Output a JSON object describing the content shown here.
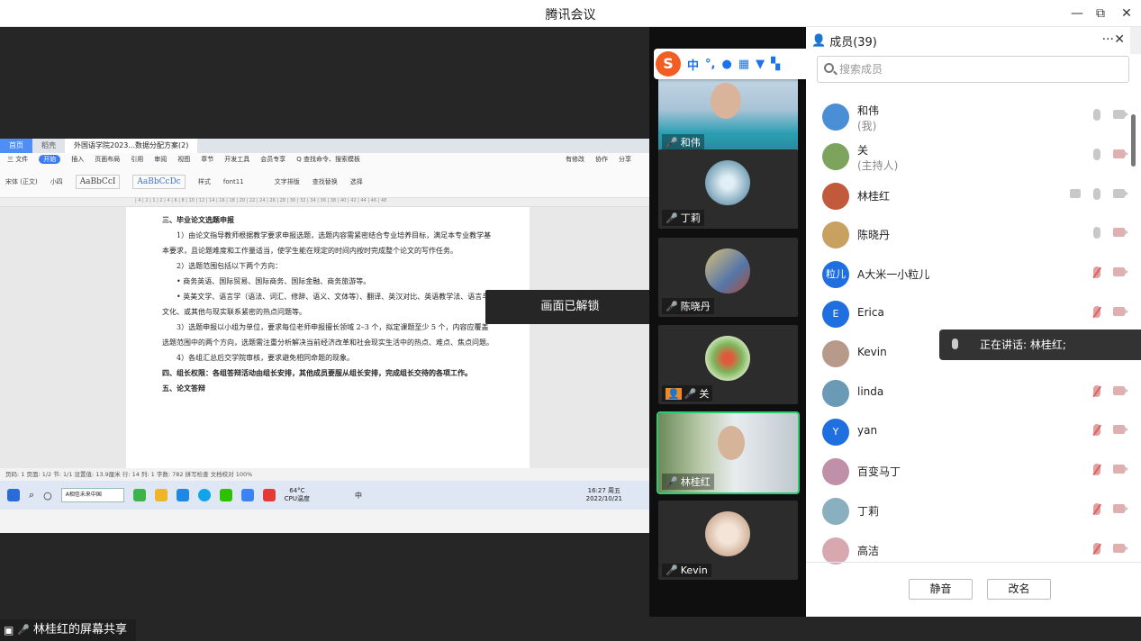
{
  "window": {
    "title": "腾讯会议",
    "minimize": "—",
    "restore": "⧉",
    "close": "✕"
  },
  "shared_screen": {
    "wps_tabs": [
      "首页",
      "稻壳",
      "外国语学院2023...数据分配方案(2)"
    ],
    "wps_menu": [
      "三 文件",
      "开始",
      "插入",
      "页面布局",
      "引用",
      "审阅",
      "视图",
      "章节",
      "开发工具",
      "会员专享",
      "Q 查找命令、搜索模板"
    ],
    "wps_menu_right": [
      "有修改",
      "协作",
      "分享"
    ],
    "ribbon": {
      "font": "宋体 (正文)",
      "size": "小四",
      "style_sample1": "AaBbCcI",
      "style_sample2": "AaBbCcDc",
      "style_label": "样式",
      "font11": "font11",
      "text_layout": "文字排版",
      "find_replace": "查找替换",
      "select": "选择"
    },
    "doc_lines": [
      {
        "text": "三、毕业论文选题申报",
        "cls": "h"
      },
      {
        "text": "1）由论文指导教师根据教学要求申报选题，选题内容需紧密结合专业培养目标，满足本专业教学基本要求，且论题难度和工作量适当，使学生能在规定的时间内按时完成整个论文的写作任务。",
        "cls": "ind"
      },
      {
        "text": "2）选题范围包括以下两个方向：",
        "cls": "ind"
      },
      {
        "text": "• 商务英语、国际贸易、国际商务、国际金融、商务旅游等。",
        "cls": "ind"
      },
      {
        "text": "• 英美文学、语言学（语法、词汇、修辞、语义、文体等）、翻译、英汉对比、英语教学法、语言与文化、或其他与现实联系紧密的热点问题等。",
        "cls": "ind"
      },
      {
        "text": "3）选题申报以小组为单位，要求每位老师申报擅长领域 2–3 个，拟定课题至少 5 个，内容应覆盖选题范围中的两个方向，选题需注重分析解决当前经济改革和社会现实生活中的热点、难点、焦点问题。",
        "cls": "ind"
      },
      {
        "text": "4）各组汇总后交学院审核，要求避免相同命题的现象。",
        "cls": "ind"
      },
      {
        "text": "四、组长权限：各组答辩活动由组长安排，其他成员要服从组长安排，完成组长交待的各项工作。",
        "cls": "h"
      },
      {
        "text": "五、论文答辩",
        "cls": "h"
      }
    ],
    "status_bar": "页码: 1   页面: 1/2   节: 1/1   设置值: 13.9厘米   行: 14   列: 1   字数: 782   拼写检查   文档校对                                            100%",
    "taskbar": {
      "search": "A相信未来中国",
      "weather_temp": "64°C",
      "weather_label": "CPU温度",
      "time": "16:27 周五",
      "date": "2022/10/21",
      "ime": "中"
    },
    "unlock_toast": "画面已解锁",
    "sharer_label": "林桂红的屏幕共享"
  },
  "ime_bar": {
    "logo": "S",
    "mode": "中",
    "punct": "°,",
    "items": [
      "mic",
      "keyboard",
      "shirt",
      "grid"
    ]
  },
  "video_tiles": [
    {
      "name": "和伟",
      "mic": "on"
    },
    {
      "name": "丁莉",
      "mic": "muted"
    },
    {
      "name": "陈晓丹",
      "mic": "on"
    },
    {
      "name": "关",
      "mic": "on",
      "host": true
    },
    {
      "name": "林桂红",
      "mic": "speaking"
    },
    {
      "name": "Kevin",
      "mic": "muted"
    }
  ],
  "members_panel": {
    "title": "成员(39)",
    "more": "···",
    "close": "✕",
    "search_placeholder": "搜索成员",
    "members": [
      {
        "name": "和伟",
        "role": "(我)",
        "mic": "on",
        "cam": "on",
        "avatar_text": "",
        "avatar_color": "#4a8ed6"
      },
      {
        "name": "关",
        "role": "(主持人)",
        "mic": "on",
        "cam": "off",
        "avatar_text": "",
        "avatar_color": "#7da35c"
      },
      {
        "name": "林桂红",
        "role": "",
        "mic": "on",
        "cam": "on",
        "share": true,
        "avatar_text": "",
        "avatar_color": "#c05a3a"
      },
      {
        "name": "陈晓丹",
        "role": "",
        "mic": "on",
        "cam": "off",
        "avatar_text": "",
        "avatar_color": "#c8a060"
      },
      {
        "name": "A大米一小粒儿",
        "role": "",
        "mic": "off",
        "cam": "off",
        "avatar_text": "粒儿",
        "avatar_color": "#1f6fe0"
      },
      {
        "name": "Erica",
        "role": "",
        "mic": "off",
        "cam": "off",
        "avatar_text": "E",
        "avatar_color": "#1f6fe0"
      },
      {
        "name": "Kevin",
        "role": "",
        "mic": "off",
        "cam": "off",
        "avatar_text": "",
        "avatar_color": "#b89a8a"
      },
      {
        "name": "linda",
        "role": "",
        "mic": "off",
        "cam": "off",
        "avatar_text": "",
        "avatar_color": "#6a9ab5"
      },
      {
        "name": "yan",
        "role": "",
        "mic": "off",
        "cam": "off",
        "avatar_text": "Y",
        "avatar_color": "#1f6fe0"
      },
      {
        "name": "百变马丁",
        "role": "",
        "mic": "off",
        "cam": "off",
        "avatar_text": "",
        "avatar_color": "#c090a8"
      },
      {
        "name": "丁莉",
        "role": "",
        "mic": "off",
        "cam": "off",
        "avatar_text": "",
        "avatar_color": "#8ab0c0"
      },
      {
        "name": "高洁",
        "role": "",
        "mic": "off",
        "cam": "off",
        "avatar_text": "",
        "avatar_color": "#d8a8b0"
      }
    ],
    "speaking_toast": "正在讲话: 林桂红;",
    "mute_all": "静音",
    "rename": "改名"
  }
}
